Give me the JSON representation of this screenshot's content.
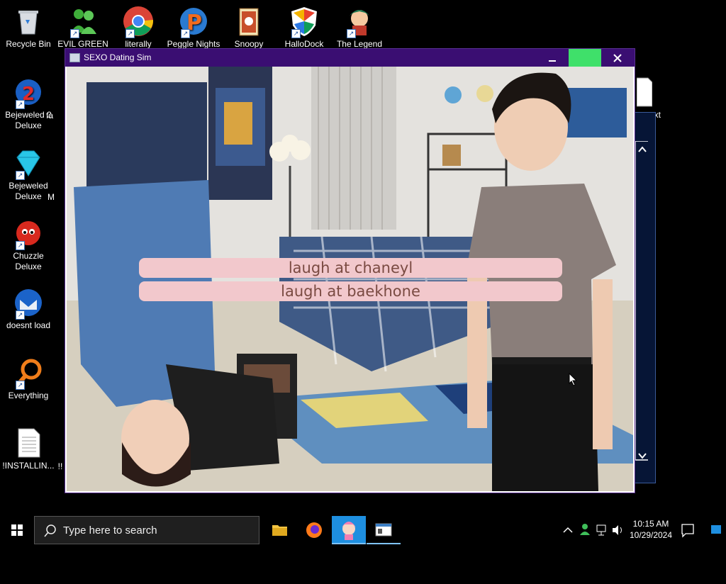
{
  "desktop": {
    "icons": [
      {
        "label": "Recycle Bin"
      },
      {
        "label": "EVIL GREEN"
      },
      {
        "label": "literally"
      },
      {
        "label": "Peggle Nights"
      },
      {
        "label": "Snoopy"
      },
      {
        "label": "HalloDock"
      },
      {
        "label": "The Legend"
      },
      {
        "label": "Bejeweled 2 Deluxe"
      },
      {
        "label": "fa"
      },
      {
        "label": "Bejeweled Deluxe"
      },
      {
        "label": "M"
      },
      {
        "label": "Chuzzle Deluxe"
      },
      {
        "label": "doesnt load"
      },
      {
        "label": "Everything"
      },
      {
        "label": "!INSTALLIN..."
      },
      {
        "label": "!!"
      },
      {
        "label": "xt"
      }
    ]
  },
  "window": {
    "title": "SEXO Dating Sim",
    "minimize_symbol": "🗕",
    "maximize_symbol": "□",
    "close_symbol": "✕"
  },
  "game": {
    "choices": [
      "laugh at chaneyl",
      "laugh at baekhone"
    ]
  },
  "taskbar": {
    "search_placeholder": "Type here to search",
    "time": "10:15 AM",
    "date": "10/29/2024"
  },
  "colors": {
    "titlebar": "#3a0e72",
    "maximize_highlight": "#3fe06a",
    "choice_bg": "#f2c8cc",
    "choice_text": "#7a4b42"
  }
}
